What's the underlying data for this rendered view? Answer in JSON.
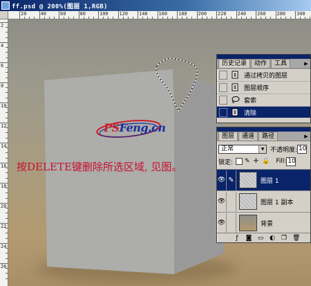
{
  "document": {
    "title": "ff.psd @ 200%(图层 1,RGB)",
    "ruler_h_labels": [
      "20",
      "40",
      "60",
      "80",
      "100",
      "120",
      "140",
      "160",
      "180",
      "200",
      "220",
      "240",
      "260",
      "280",
      "300"
    ],
    "ruler_v_labels": [
      "2",
      "4",
      "6",
      "8",
      "10",
      "12",
      "14",
      "16",
      "18",
      "20",
      "22",
      "24",
      "26"
    ]
  },
  "watermark": {
    "part1": "PS",
    "part2": "Feng.cn"
  },
  "instruction_text": "按DELETE键删除所选区域, 见图。",
  "history_panel": {
    "tabs": [
      "历史记录",
      "动作",
      "工具"
    ],
    "menu_icon": "triangle-right",
    "items": [
      {
        "label": "通过拷贝的图层",
        "icon": "document-icon",
        "active": false
      },
      {
        "label": "图层顺序",
        "icon": "document-icon",
        "active": false
      },
      {
        "label": "套索",
        "icon": "lasso-icon",
        "active": false
      },
      {
        "label": "清除",
        "icon": "document-icon",
        "active": true
      }
    ]
  },
  "layers_panel": {
    "tabs": [
      "图层",
      "通道",
      "路径"
    ],
    "blend_mode": "正常",
    "opacity_label": "不透明度:",
    "opacity_value": "10",
    "lock_label": "锁定:",
    "fill_label": "Fill:",
    "fill_value": "10",
    "layers": [
      {
        "name": "图层 1",
        "active": true,
        "visible": true,
        "thumb": "gray"
      },
      {
        "name": "图层 1 副本",
        "active": false,
        "visible": true,
        "thumb": "gray"
      },
      {
        "name": "背景",
        "active": false,
        "visible": true,
        "thumb": "tan"
      }
    ],
    "bottom_icons": [
      "layer-style-icon",
      "mask-icon",
      "folder-icon",
      "adjustment-icon",
      "new-layer-icon",
      "trash-icon"
    ]
  },
  "colors": {
    "highlight": "#0a246a",
    "instruction": "#c8102e",
    "logo_red": "#c8202a",
    "logo_blue": "#1a2f9a"
  }
}
